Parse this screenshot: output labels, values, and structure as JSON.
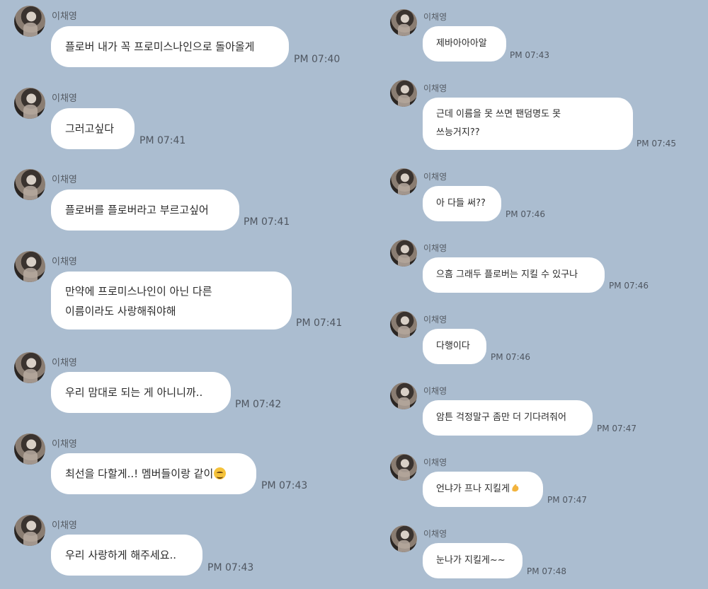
{
  "sender": "이채영",
  "left_messages": [
    {
      "text": [
        "플로버 내가 꼭 프로미스나인으로 돌아올게"
      ],
      "time": "PM 07:40"
    },
    {
      "text": [
        "그러고싶다"
      ],
      "time": "PM 07:41"
    },
    {
      "text": [
        "플로버를 플로버라고 부르고싶어"
      ],
      "time": "PM 07:41"
    },
    {
      "text": [
        "만약에 프로미스나인이 아닌 다른",
        "이름이라도 사랑해줘야해"
      ],
      "time": "PM 07:41"
    },
    {
      "text": [
        "우리 맘대로 되는 게 아니니까.."
      ],
      "time": "PM 07:42"
    },
    {
      "text": [
        "최선을 다할게..! 멤버들이랑 같이"
      ],
      "emoji": "smiling-face-emoji",
      "time": "PM 07:43"
    },
    {
      "text": [
        "우리 사랑하게 해주세요.."
      ],
      "time": "PM 07:43"
    }
  ],
  "right_messages": [
    {
      "text": [
        "제바아아아알"
      ],
      "time": "PM 07:43"
    },
    {
      "text": [
        "근데 이름을 못 쓰면 팬덤명도 못",
        "쓰능거지??"
      ],
      "time": "PM 07:45"
    },
    {
      "text": [
        "아 다들 써??"
      ],
      "time": "PM 07:46"
    },
    {
      "text": [
        "으흠 그래두 플로버는 지킬 수 있구나"
      ],
      "time": "PM 07:46"
    },
    {
      "text": [
        "다행이다"
      ],
      "time": "PM 07:46"
    },
    {
      "text": [
        "암튼 걱정말구 좀만 더 기다려줘어"
      ],
      "time": "PM 07:47"
    },
    {
      "text": [
        "언냐가 프나 지킬게"
      ],
      "emoji": "flexed-biceps-emoji",
      "time": "PM 07:47"
    },
    {
      "text": [
        "눈나가 지킬게~~"
      ],
      "time": "PM 07:48"
    }
  ],
  "colors": {
    "background": "#abbdd0",
    "bubble": "#ffffff"
  }
}
